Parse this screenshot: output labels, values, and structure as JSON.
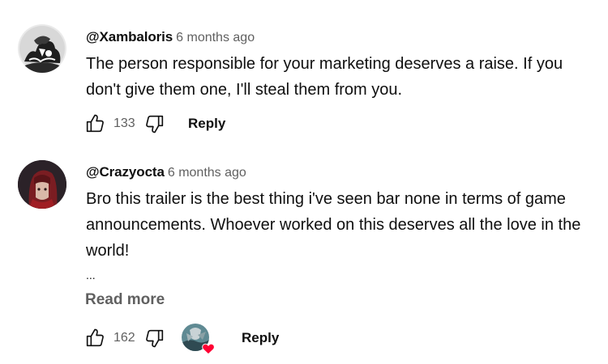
{
  "comments": [
    {
      "author": "@Xambaloris",
      "time": "6 months ago",
      "text": "The person responsible for your marketing deserves a raise. If you don't give them one, I'll steal them from you.",
      "likes": "133",
      "reply_label": "Reply",
      "icons": {
        "avatar": "user-avatar-sketch",
        "like": "thumbs-up-icon",
        "dislike": "thumbs-down-icon"
      }
    },
    {
      "author": "@Crazyocta",
      "time": "6 months ago",
      "text": "Bro this trailer is the best thing i've seen bar none in terms of game announcements. Whoever worked on this deserves all the love in the world!",
      "ellipsis": "...",
      "read_more": "Read more",
      "likes": "162",
      "reply_label": "Reply",
      "icons": {
        "avatar": "user-avatar-red-hair",
        "like": "thumbs-up-icon",
        "dislike": "thumbs-down-icon",
        "creator_heart": "creator-heart-icon"
      }
    }
  ],
  "colors": {
    "text": "#0f0f0f",
    "secondary": "#606060",
    "heart": "#ff0033"
  }
}
